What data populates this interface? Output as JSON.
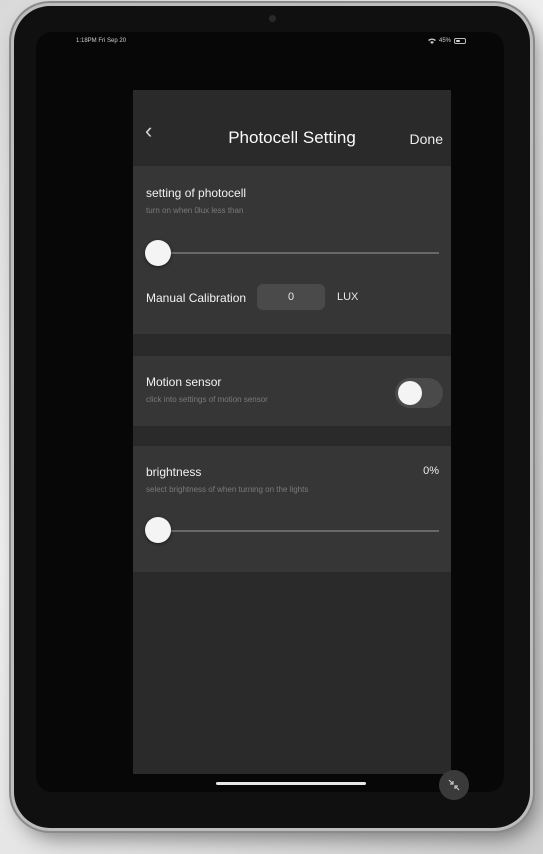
{
  "status_bar": {
    "time_date": "1:18PM  Fri Sep 20",
    "battery_text": "45%",
    "battery_level": 0.45
  },
  "nav": {
    "back_icon": "‹",
    "title": "Photocell Setting",
    "done_label": "Done"
  },
  "photocell": {
    "title": "setting of photocell",
    "subtitle": "turn on when 0lux less than",
    "slider_value": 0,
    "calibration_label": "Manual Calibration",
    "calibration_value": "0",
    "unit": "LUX"
  },
  "motion": {
    "title": "Motion sensor",
    "subtitle": "click into settings of motion sensor",
    "enabled": false
  },
  "brightness": {
    "title": "brightness",
    "subtitle": "select brightness of when turning on the lights",
    "value_label": "0%",
    "slider_value": 0
  },
  "icons": {
    "back": "chevron-left-icon",
    "minimize": "collapse-arrows-icon",
    "battery": "battery-icon",
    "wifi": "wifi-icon"
  },
  "colors": {
    "panel": "#363636",
    "modal": "#2a2a2a",
    "thumb": "#f4f4f4"
  }
}
